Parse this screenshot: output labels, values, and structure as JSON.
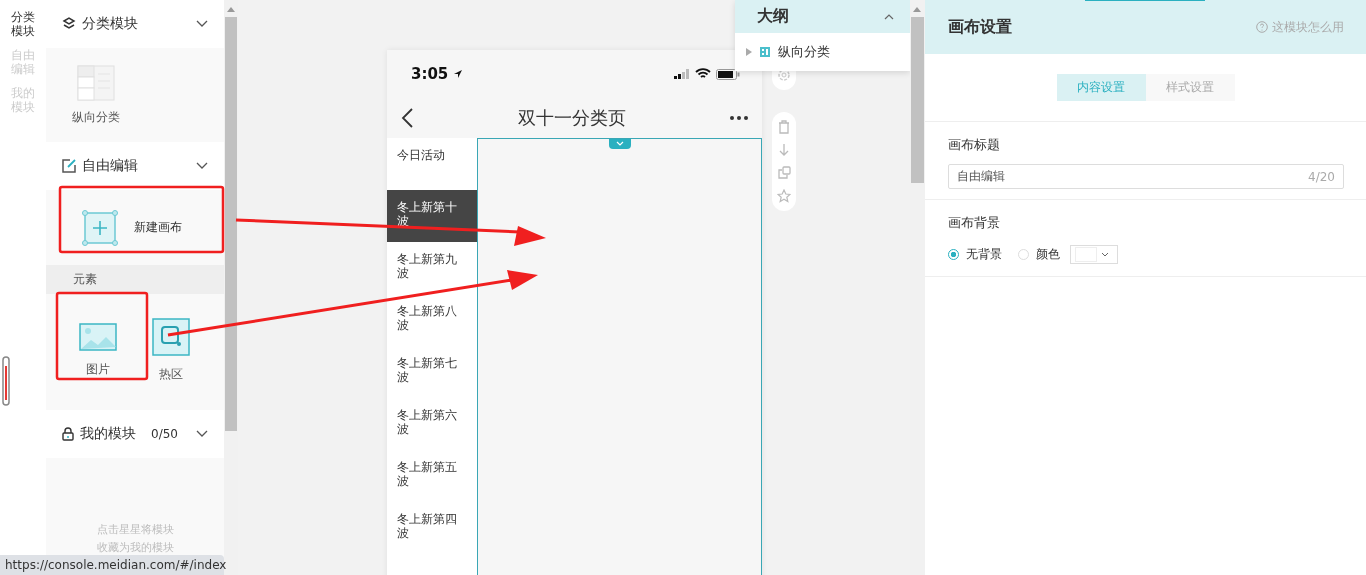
{
  "rail": [
    {
      "label": "分类模块",
      "selected": true
    },
    {
      "label": "自由编辑",
      "selected": false
    },
    {
      "label": "我的模块",
      "selected": false
    }
  ],
  "category_section": {
    "title": "分类模块",
    "items": [
      {
        "label": "纵向分类"
      }
    ]
  },
  "free_edit_section": {
    "title": "自由编辑",
    "new_canvas": "新建画布",
    "elements_heading": "元素",
    "elements": [
      {
        "label": "图片",
        "kind": "image"
      },
      {
        "label": "热区",
        "kind": "hotspot"
      }
    ]
  },
  "my_section": {
    "title": "我的模块",
    "count": "0/50",
    "hint": "点击星星将模块收藏为我的模块"
  },
  "status_url": "https://console.meidian.com/#/index",
  "phone": {
    "time": "3:05",
    "title": "双十一分类页",
    "menu": [
      {
        "label": "今日活动",
        "selected": false
      },
      {
        "label": "冬上新第十波",
        "selected": true
      },
      {
        "label": "冬上新第九波",
        "selected": false
      },
      {
        "label": "冬上新第八波",
        "selected": false
      },
      {
        "label": "冬上新第七波",
        "selected": false
      },
      {
        "label": "冬上新第六波",
        "selected": false
      },
      {
        "label": "冬上新第五波",
        "selected": false
      },
      {
        "label": "冬上新第四波",
        "selected": false
      }
    ]
  },
  "outline": {
    "title": "大纲",
    "items": [
      {
        "label": "纵向分类"
      }
    ]
  },
  "settings": {
    "title": "画布设置",
    "help": "这模块怎么用",
    "tabs": [
      {
        "label": "内容设置",
        "selected": true
      },
      {
        "label": "样式设置",
        "selected": false
      }
    ],
    "title_label": "画布标题",
    "title_value": "自由编辑",
    "title_count": "4/20",
    "background_label": "画布背景",
    "background_options": [
      {
        "label": "无背景",
        "selected": true
      },
      {
        "label": "颜色",
        "selected": false
      }
    ]
  }
}
